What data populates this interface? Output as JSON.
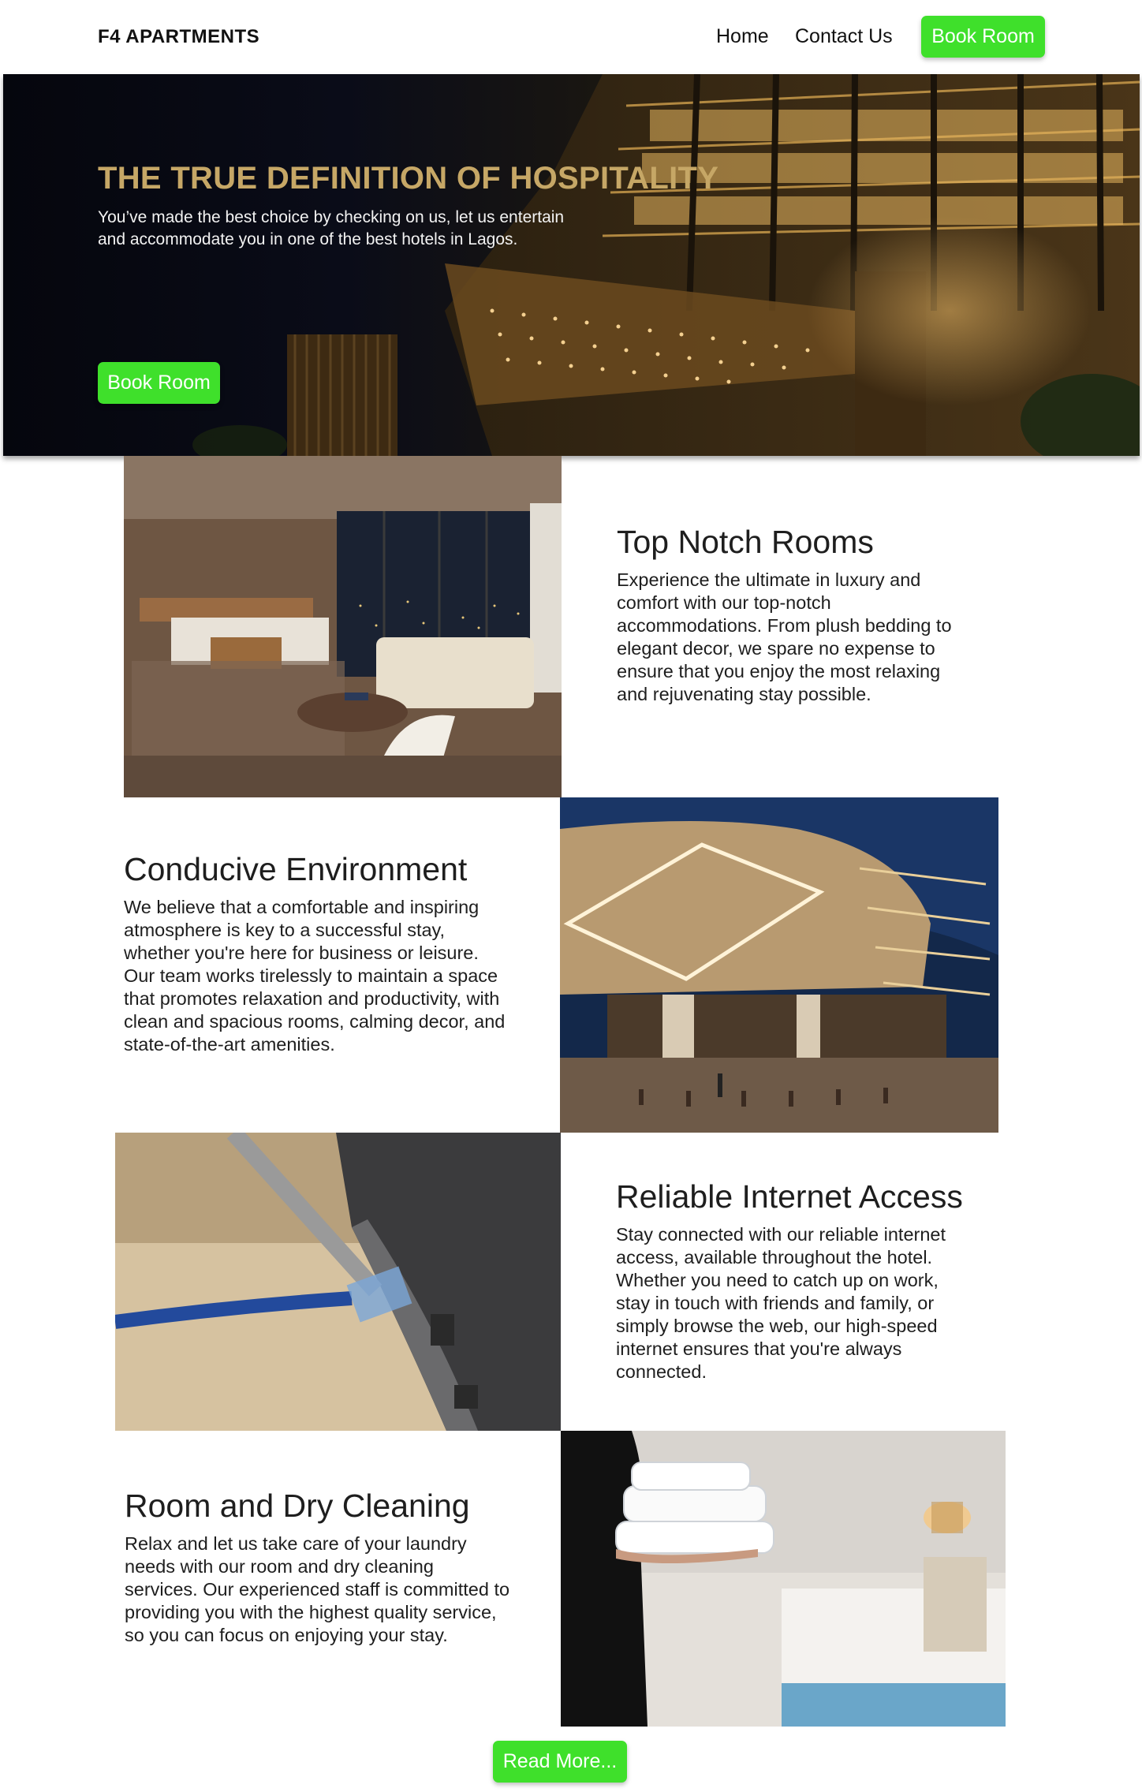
{
  "header": {
    "brand": "F4 APARTMENTS",
    "nav": {
      "home": "Home",
      "contact": "Contact Us",
      "book": "Book Room"
    }
  },
  "hero": {
    "title": "THE TRUE DEFINITION OF HOSPITALITY",
    "subtitle": "You’ve made the best choice by checking on us, let us entertain and accommodate you in one of the best hotels in Lagos.",
    "button": "Book Room"
  },
  "features": [
    {
      "title": "Top Notch Rooms",
      "text": "Experience the ultimate in luxury and comfort with our top-notch accommodations. From plush bedding to elegant decor, we spare no expense to ensure that you enjoy the most relaxing and rejuvenating stay possible."
    },
    {
      "title": "Conducive Environment",
      "text": "We believe that a comfortable and inspiring atmosphere is key to a successful stay, whether you're here for business or leisure. Our team works tirelessly to maintain a space that promotes relaxation and productivity, with clean and spacious rooms, calming decor, and state-of-the-art amenities."
    },
    {
      "title": "Reliable Internet Access",
      "text": "Stay connected with our reliable internet access, available throughout the hotel. Whether you need to catch up on work, stay in touch with friends and family, or simply browse the web, our high-speed internet ensures that you're always connected."
    },
    {
      "title": "Room and Dry Cleaning",
      "text": "Relax and let us take care of your laundry needs with our room and dry cleaning services. Our experienced staff is committed to providing you with the highest quality service, so you can focus on enjoying your stay."
    }
  ],
  "read_more": "Read More...",
  "colors": {
    "accent": "#3fe02b",
    "hero_title": "#c6a766"
  }
}
